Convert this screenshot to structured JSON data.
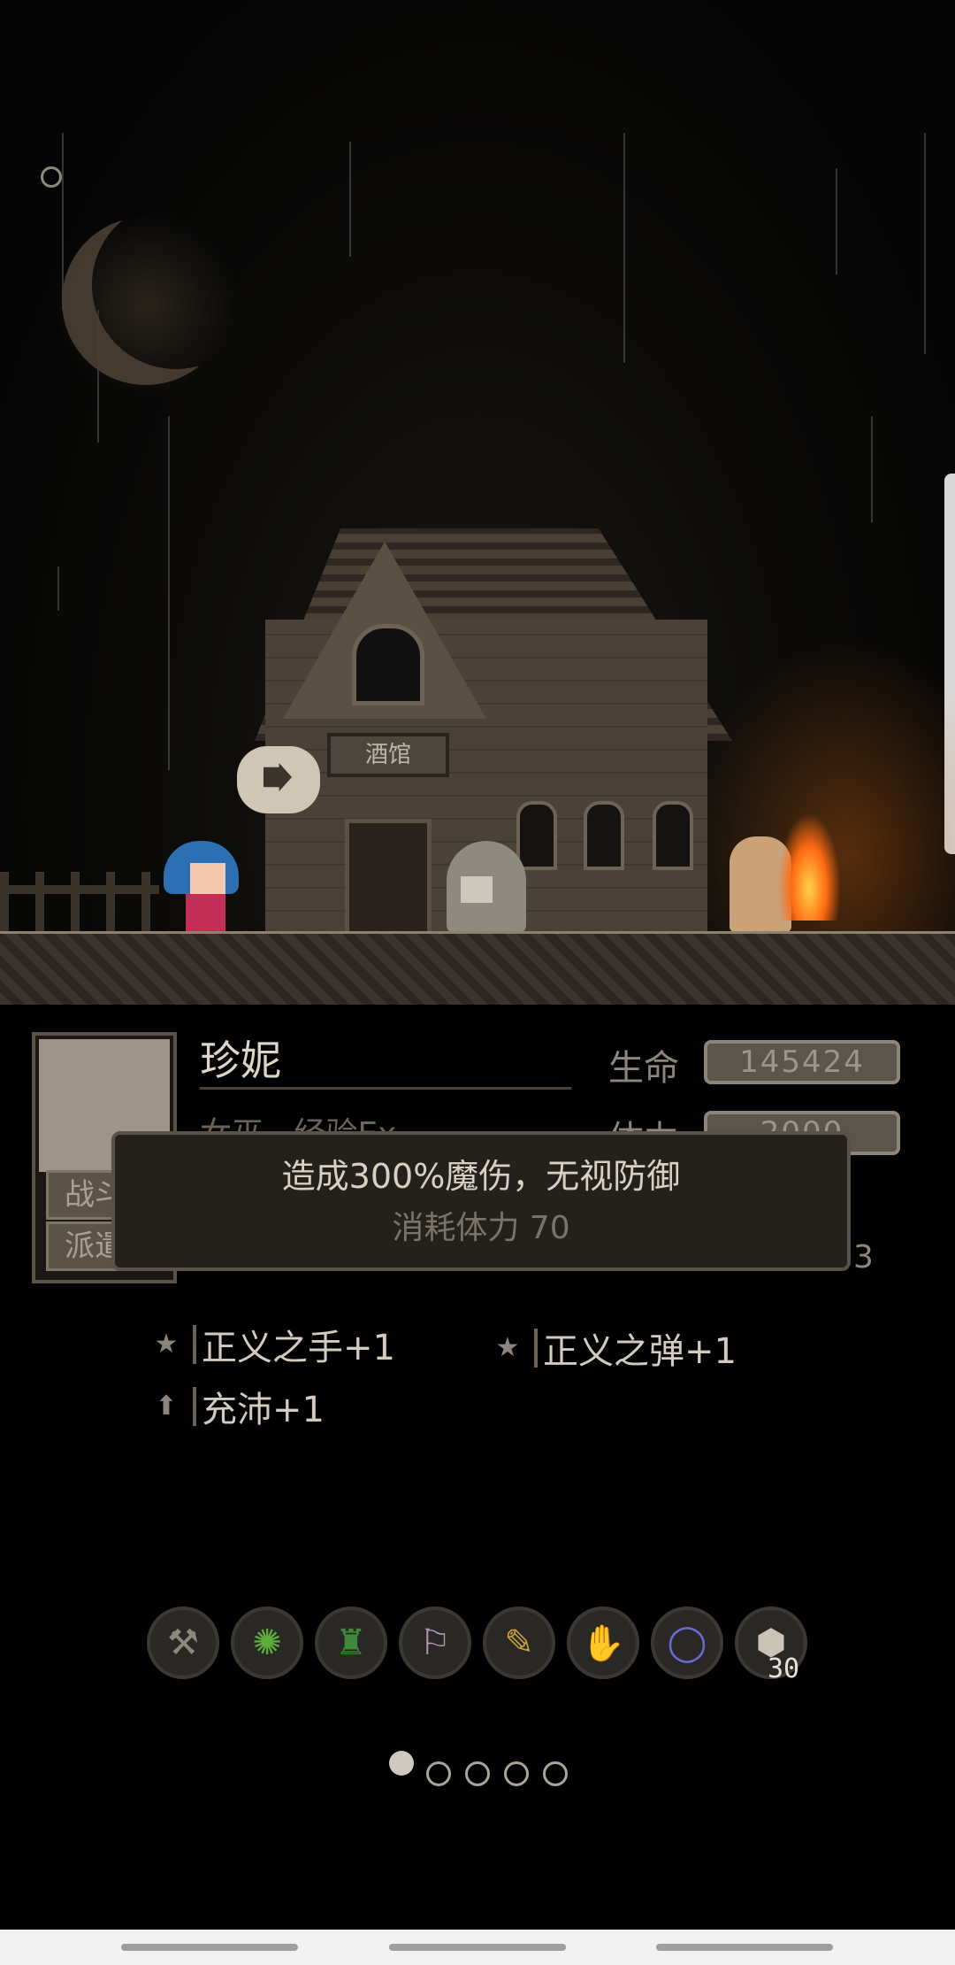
{
  "scene": {
    "tavern_sign": "酒馆",
    "speech_icon": "exit-door-icon"
  },
  "character": {
    "name": "珍妮",
    "class_text": "女巫 · 经验Ex",
    "side_buttons": [
      "战斗",
      "派遣"
    ],
    "stats": [
      {
        "label": "生命",
        "value": "145424"
      },
      {
        "label": "体力",
        "value": "2000"
      }
    ],
    "stats_row_end": "/33"
  },
  "tooltip": {
    "main": "造成300%魔伤，无视防御",
    "sub": "消耗体力 70"
  },
  "skills": [
    {
      "icon": "star-icon",
      "label": "正义之手+1"
    },
    {
      "icon": "star-icon",
      "label": "正义之弹+1"
    },
    {
      "icon": "arrow-up-icon",
      "label": "充沛+1"
    }
  ],
  "equipment": [
    {
      "icon": "axe-icon"
    },
    {
      "icon": "beetle-amulet-icon"
    },
    {
      "icon": "green-robe-icon"
    },
    {
      "icon": "boots-icon"
    },
    {
      "icon": "scroll-icon"
    },
    {
      "icon": "gloves-icon"
    },
    {
      "icon": "ring-icon"
    },
    {
      "icon": "ore-stack-icon",
      "count": "30"
    }
  ],
  "pager": {
    "pages": 5,
    "active": 1
  }
}
